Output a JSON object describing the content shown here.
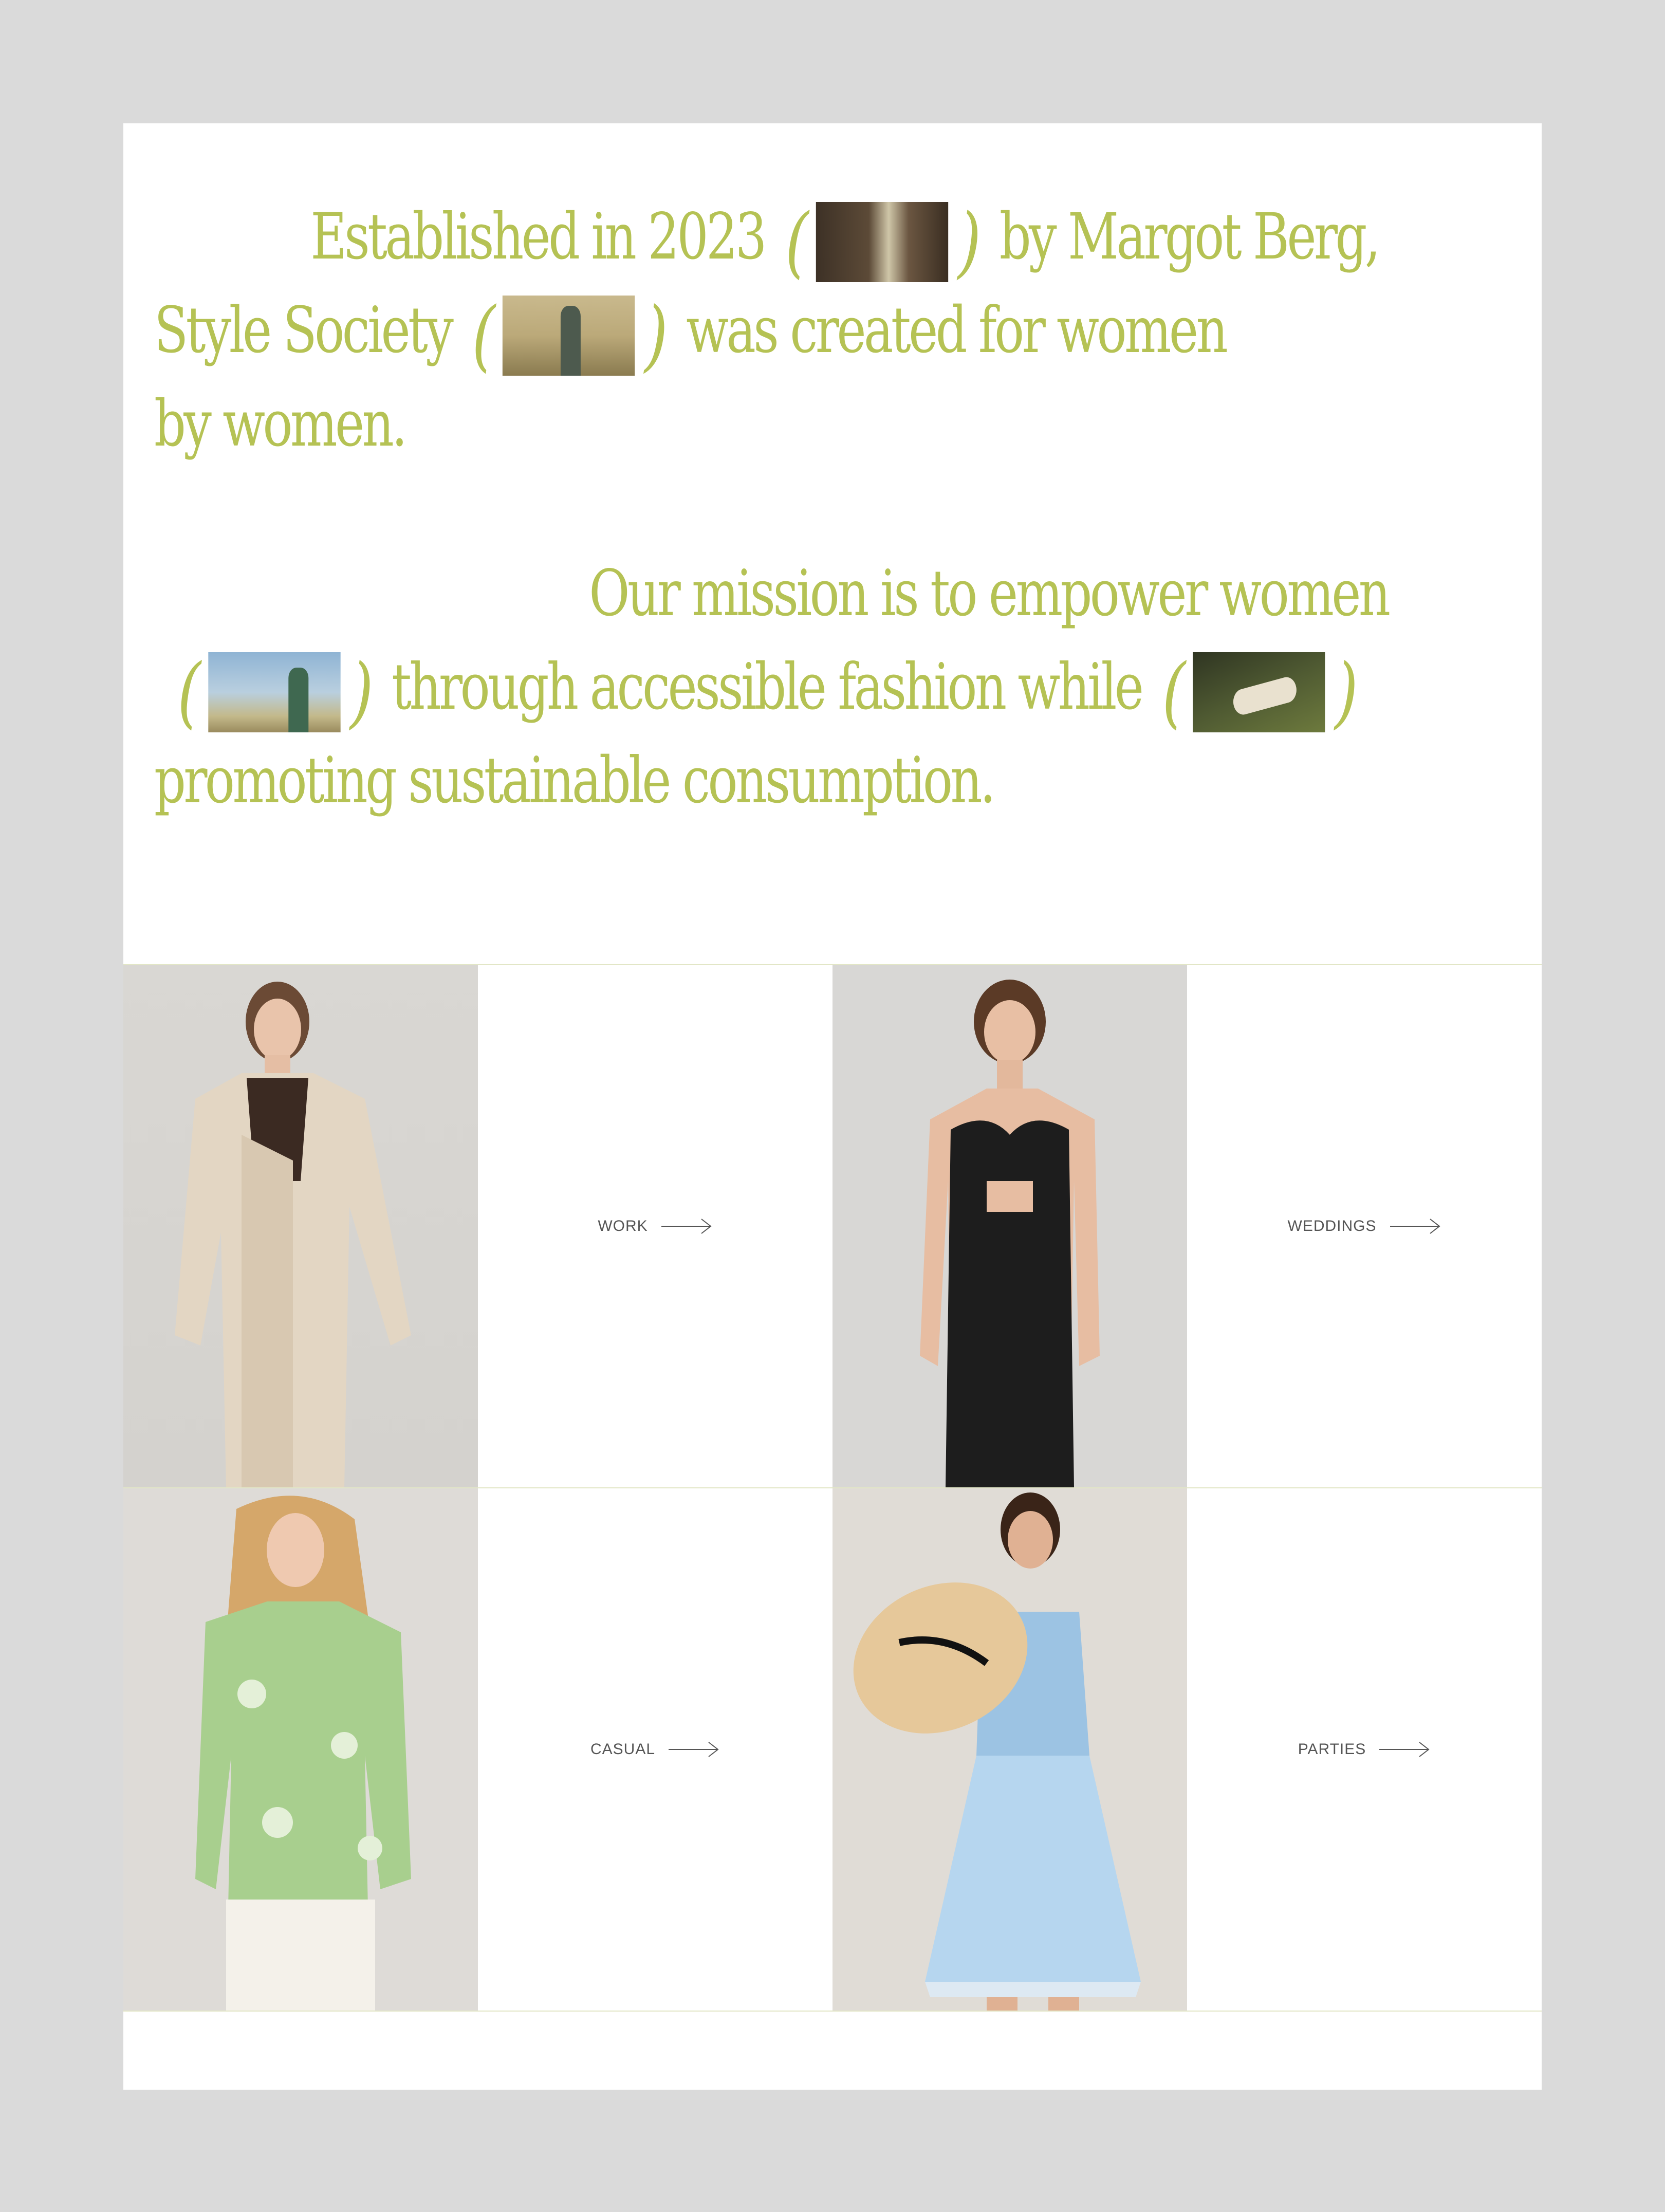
{
  "intro": {
    "line1_a": "Established in 2023",
    "line1_b": "by Margot Berg,",
    "line2_a": "Style Society",
    "line2_b": "was created for women",
    "line3": "by women.",
    "line4": "Our mission is to empower women",
    "line5_a": "through accessible fashion while",
    "line6": "promoting sustainable consumption.",
    "paren_open": "(",
    "paren_close": ")"
  },
  "categories": [
    {
      "label": "WORK"
    },
    {
      "label": "WEDDINGS"
    },
    {
      "label": "CASUAL"
    },
    {
      "label": "PARTIES"
    }
  ],
  "colors": {
    "accent": "#b5c254",
    "background": "#dadada",
    "card": "#ffffff",
    "divider": "#e2e6c6"
  },
  "icons": {
    "category_arrow": "arrow-right-icon"
  }
}
